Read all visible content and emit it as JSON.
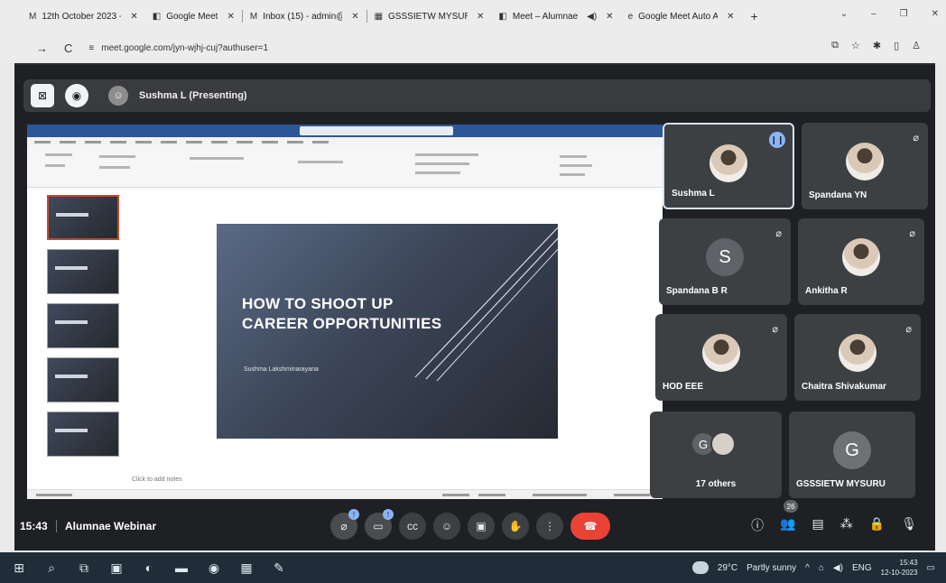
{
  "browser": {
    "tabs": [
      {
        "icon": "gmail-icon",
        "glyph": "M",
        "title": "12th October 2023 -"
      },
      {
        "icon": "meet-icon",
        "glyph": "◧",
        "title": "Google Meet"
      },
      {
        "icon": "gmail-icon",
        "glyph": "M",
        "title": "Inbox (15) - admin@"
      },
      {
        "icon": "calendar-icon",
        "glyph": "▦",
        "title": "GSSSIETW MYSURU"
      },
      {
        "icon": "meet-icon",
        "glyph": "◧",
        "title": "Meet – Alumnae"
      },
      {
        "icon": "edge-icon",
        "glyph": "e",
        "title": "Google Meet Auto A"
      }
    ],
    "url": "meet.google.com/jyn-wjhj-cuj?authuser=1"
  },
  "meet": {
    "presenter_label": "Sushma L (Presenting)",
    "time": "15:43",
    "meeting_name": "Alumnae Webinar",
    "participants_count": "26",
    "participants": [
      {
        "name": "Sushma L",
        "avatar": "photo",
        "speaking": true
      },
      {
        "name": "Spandana YN",
        "avatar": "photo",
        "muted": true
      },
      {
        "name": "Spandana B R",
        "avatar": "S",
        "muted": true
      },
      {
        "name": "Ankitha R",
        "avatar": "photo",
        "muted": true
      },
      {
        "name": "HOD EEE",
        "avatar": "photo",
        "muted": true
      },
      {
        "name": "Chaitra Shivakumar",
        "avatar": "photo",
        "muted": true
      },
      {
        "name": "17 others",
        "avatar": "G"
      },
      {
        "name": "GSSSIETW MYSURU",
        "avatar": "G"
      }
    ]
  },
  "slide": {
    "title_line1": "HOW TO SHOOT UP",
    "title_line2": "CAREER OPPORTUNITIES",
    "subtitle": "Sushma Lakshminarayana"
  },
  "notes_hint": "Click to add notes",
  "taskbar": {
    "temperature": "29°C",
    "weather": "Partly sunny",
    "language": "ENG",
    "time": "15:43",
    "date": "12-10-2023"
  },
  "colors": {
    "meet_bg": "#1f2023",
    "tile_bg": "#3c4043",
    "end_call": "#ea4335",
    "taskbar": "#202c38",
    "ppt_blue": "#2b579a"
  }
}
